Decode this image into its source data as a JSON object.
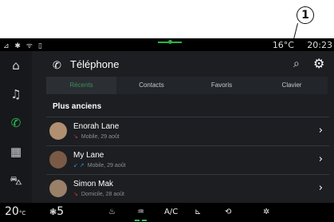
{
  "callout": {
    "number": "1"
  },
  "statusbar": {
    "left_icons": "⊿ ✱ ᯤ ▯",
    "temperature": "16°C",
    "time": "20:23"
  },
  "sidebar": {
    "items": [
      {
        "icon": "home-icon",
        "glyph": "⌂"
      },
      {
        "icon": "music-icon",
        "glyph": "♫"
      },
      {
        "icon": "phone-icon",
        "glyph": "✆",
        "active": true
      },
      {
        "icon": "apps-icon",
        "glyph": "▦"
      },
      {
        "icon": "car-icon",
        "glyph": "⛍"
      }
    ]
  },
  "header": {
    "title": "Téléphone",
    "phone_glyph": "✆",
    "search_glyph": "⌕",
    "settings_glyph": "⚙"
  },
  "tabs": [
    {
      "label": "Récents",
      "active": true
    },
    {
      "label": "Contacts"
    },
    {
      "label": "Favoris"
    },
    {
      "label": "Clavier"
    }
  ],
  "section_title": "Plus anciens",
  "calls": [
    {
      "name": "Enorah Lane",
      "detail": "Mobile, 29 août",
      "call_glyph": "↘",
      "call_color": "#d23b3b"
    },
    {
      "name": "My Lane",
      "detail": "Mobile, 29 août",
      "call_glyph": "↙ ↗",
      "call_color": "#2fbf5a"
    },
    {
      "name": "Simon Mak",
      "detail": "Domicile, 28 août",
      "call_glyph": "↘",
      "call_color": "#d23b3b"
    }
  ],
  "chevron": "›",
  "bottombar": {
    "left_temp": "20",
    "left_temp_unit": "°C",
    "fan_glyph": "❃",
    "fan_speed": "5",
    "seat_heat_glyph": "♨",
    "rear_defrost_glyph": "♒",
    "ac_label": "A/C",
    "seat_glyph": "⊾",
    "recirc_glyph": "⟲",
    "auto_glyph": "✲"
  },
  "colors": {
    "accent": "#2fbf5a",
    "background": "#1c1e22",
    "missed": "#d23b3b"
  }
}
